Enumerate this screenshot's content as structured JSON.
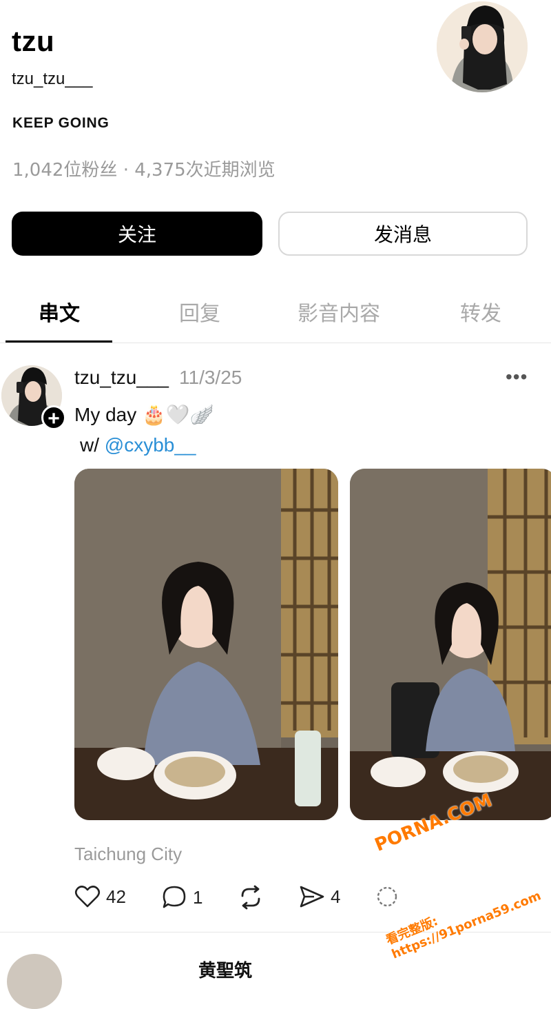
{
  "profile": {
    "name": "tzu",
    "handle": "tzu_tzu___",
    "bio": "KEEP GOING",
    "stats": "1,042位粉丝 · 4,375次近期浏览"
  },
  "buttons": {
    "follow": "关注",
    "message": "发消息"
  },
  "tabs": [
    {
      "label": "串文",
      "active": true
    },
    {
      "label": "回复",
      "active": false
    },
    {
      "label": "影音内容",
      "active": false
    },
    {
      "label": "转发",
      "active": false
    }
  ],
  "post": {
    "username": "tzu_tzu___",
    "date": "11/3/25",
    "text": "My day 🎂🤍🪽",
    "with_prefix": "w/",
    "mention": "@cxybb__",
    "location": "Taichung City",
    "actions": {
      "likes": "42",
      "comments": "1",
      "shares": "4"
    }
  },
  "next_post": {
    "username": "黄聖筑"
  },
  "watermark": {
    "brand": "PORNA.COM",
    "sub": "看完整版: https://91porna59.com"
  },
  "colors": {
    "accent_link": "#2a8fd6",
    "muted_text": "#9a9a9a",
    "watermark": "#ff7a00"
  }
}
